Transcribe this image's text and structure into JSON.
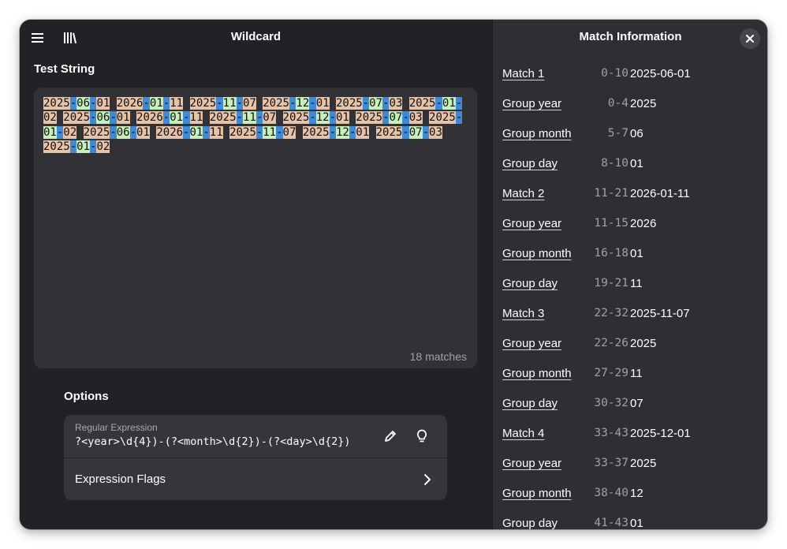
{
  "left_header": {
    "title": "Wildcard"
  },
  "right_header": {
    "title": "Match Information"
  },
  "test_string": {
    "title": "Test String",
    "matches": [
      {
        "year": "2025",
        "month": "06",
        "day": "01"
      },
      {
        "year": "2026",
        "month": "01",
        "day": "11"
      },
      {
        "year": "2025",
        "month": "11",
        "day": "07"
      },
      {
        "year": "2025",
        "month": "12",
        "day": "01"
      },
      {
        "year": "2025",
        "month": "07",
        "day": "03"
      },
      {
        "year": "2025",
        "month": "01",
        "day": "02"
      },
      {
        "year": "2025",
        "month": "06",
        "day": "01"
      },
      {
        "year": "2026",
        "month": "01",
        "day": "11"
      },
      {
        "year": "2025",
        "month": "11",
        "day": "07"
      },
      {
        "year": "2025",
        "month": "12",
        "day": "01"
      },
      {
        "year": "2025",
        "month": "07",
        "day": "03"
      },
      {
        "year": "2025",
        "month": "01",
        "day": "02"
      },
      {
        "year": "2025",
        "month": "06",
        "day": "01"
      },
      {
        "year": "2026",
        "month": "01",
        "day": "11"
      },
      {
        "year": "2025",
        "month": "11",
        "day": "07"
      },
      {
        "year": "2025",
        "month": "12",
        "day": "01"
      },
      {
        "year": "2025",
        "month": "07",
        "day": "03"
      },
      {
        "year": "2025",
        "month": "01",
        "day": "02"
      }
    ],
    "match_count": "18 matches"
  },
  "options": {
    "title": "Options",
    "regex_label": "Regular Expression",
    "regex_value": "?<year>\\d{4})-(?<month>\\d{2})-(?<day>\\d{2})",
    "flags_label": "Expression Flags"
  },
  "colors": {
    "year_highlight": "#e6c2a6",
    "month_highlight": "#c6f0b8",
    "separator_highlight": "#3f8ad6"
  },
  "match_info": [
    {
      "name": "Match 1",
      "range": "0-10",
      "value": "2025-06-01"
    },
    {
      "name": "Group year",
      "range": "0-4",
      "value": "2025"
    },
    {
      "name": "Group month",
      "range": "5-7",
      "value": "06"
    },
    {
      "name": "Group day",
      "range": "8-10",
      "value": "01"
    },
    {
      "name": "Match 2",
      "range": "11-21",
      "value": "2026-01-11"
    },
    {
      "name": "Group year",
      "range": "11-15",
      "value": "2026"
    },
    {
      "name": "Group month",
      "range": "16-18",
      "value": "01"
    },
    {
      "name": "Group day",
      "range": "19-21",
      "value": "11"
    },
    {
      "name": "Match 3",
      "range": "22-32",
      "value": "2025-11-07"
    },
    {
      "name": "Group year",
      "range": "22-26",
      "value": "2025"
    },
    {
      "name": "Group month",
      "range": "27-29",
      "value": "11"
    },
    {
      "name": "Group day",
      "range": "30-32",
      "value": "07"
    },
    {
      "name": "Match 4",
      "range": "33-43",
      "value": "2025-12-01"
    },
    {
      "name": "Group year",
      "range": "33-37",
      "value": "2025"
    },
    {
      "name": "Group month",
      "range": "38-40",
      "value": "12"
    },
    {
      "name": "Group day",
      "range": "41-43",
      "value": "01"
    }
  ]
}
